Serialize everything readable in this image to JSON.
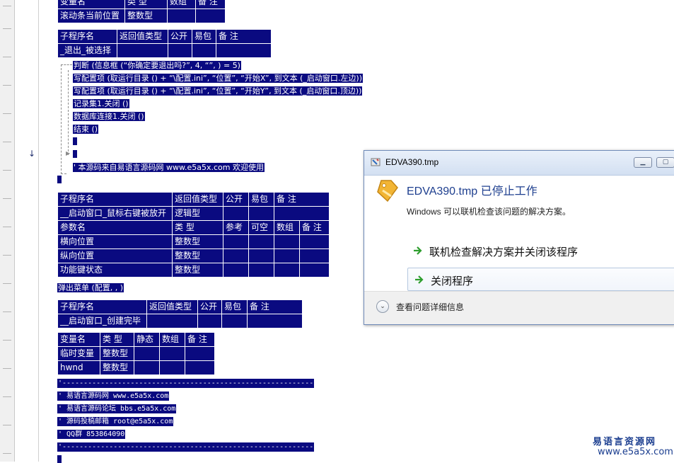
{
  "table_var_top": {
    "header": [
      "变量名",
      "类 型",
      "数组",
      "备 注"
    ],
    "row": [
      "滚动条当前位置",
      "整数型",
      "",
      ""
    ]
  },
  "table_sub1": {
    "header": [
      "子程序名",
      "返回值类型",
      "公开",
      "易包",
      "备 注"
    ],
    "row": [
      "_退出_被选择",
      "",
      "",
      "",
      ""
    ]
  },
  "code_lines": [
    "判断 (信息框 (“你确定要退出吗?”, 4, “”, ) = 5)",
    "写配置项 (取运行目录 () + “\\配置.ini”, “位置”, “开始X”, 到文本 (_启动窗口.左边))",
    "写配置项 (取运行目录 () + “\\配置.ini”, “位置”, “开始Y”, 到文本 (_启动窗口.顶边))",
    "记录集1.关闭 ()",
    "数据库连接1.关闭 ()",
    "结束 ()",
    "' 本源码来自易语言源码网 www.e5a5x.com 欢迎使用"
  ],
  "table_sub2": {
    "header": [
      "子程序名",
      "返回值类型",
      "公开",
      "易包",
      "备 注"
    ],
    "row": [
      "__启动窗口_鼠标右键被放开",
      "逻辑型",
      "",
      "",
      ""
    ],
    "param_header": [
      "参数名",
      "类 型",
      "参考",
      "可空",
      "数组",
      "备 注"
    ],
    "params": [
      [
        "横向位置",
        "整数型",
        "",
        "",
        "",
        ""
      ],
      [
        "纵向位置",
        "整数型",
        "",
        "",
        "",
        ""
      ],
      [
        "功能键状态",
        "整数型",
        "",
        "",
        "",
        ""
      ]
    ]
  },
  "popup_line": "弹出菜单 (配置, , )",
  "table_sub3": {
    "header": [
      "子程序名",
      "返回值类型",
      "公开",
      "易包",
      "备 注"
    ],
    "row": [
      "__启动窗口_创建完毕",
      "",
      "",
      "",
      ""
    ]
  },
  "table_var3": {
    "header": [
      "变量名",
      "类 型",
      "静态",
      "数组",
      "备 注"
    ],
    "rows": [
      [
        "临时变量",
        "整数型",
        "",
        "",
        ""
      ],
      [
        "hwnd",
        "整数型",
        "",
        "",
        ""
      ]
    ]
  },
  "comment_lines": [
    "'-----------------------------------------------------------",
    "' 易语言源码网    www.e5a5x.com",
    "' 易语言源码论坛    bbs.e5a5x.com",
    "' 源码投稿邮箱  root@e5a5x.com",
    "' QQ群    853864090",
    "'-----------------------------------------------------------"
  ],
  "dialog": {
    "title": "EDVA390.tmp",
    "heading": "EDVA390.tmp 已停止工作",
    "description": "Windows 可以联机检查该问题的解决方案。",
    "option1": "联机检查解决方案并关闭该程序",
    "option2": "关闭程序",
    "details": "查看问题详细信息"
  },
  "watermark": {
    "line1": "易语言资源网",
    "line2": "www.e5a5x.com"
  },
  "colors": {
    "code_bg": "#0a0a80",
    "dialog_heading": "#1e3f8f",
    "option_arrow": "#2e9e2e",
    "watermark": "#1a3d8f"
  }
}
